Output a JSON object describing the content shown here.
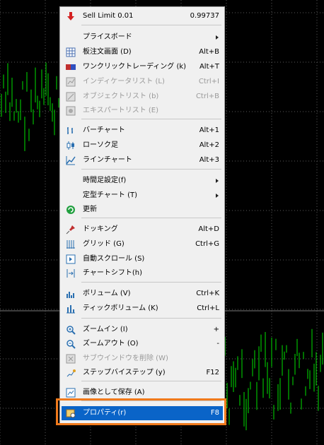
{
  "menu": {
    "items": [
      {
        "label": "Sell Limit 0.01",
        "shortcut": "0.99737",
        "icon": "sell-arrow-icon",
        "enabled": true
      },
      {
        "label": "プライスボード",
        "shortcut": "",
        "icon": "",
        "enabled": true,
        "submenu": true
      },
      {
        "label": "板注文画面 (D)",
        "shortcut": "Alt+B",
        "icon": "order-book-icon",
        "enabled": true
      },
      {
        "label": "ワンクリックトレーディング (k)",
        "shortcut": "Alt+T",
        "icon": "one-click-icon",
        "enabled": true
      },
      {
        "label": "インディケータリスト (L)",
        "shortcut": "Ctrl+I",
        "icon": "indicator-list-icon",
        "enabled": false
      },
      {
        "label": "オブジェクトリスト (b)",
        "shortcut": "Ctrl+B",
        "icon": "object-list-icon",
        "enabled": false
      },
      {
        "label": "エキスパートリスト (E)",
        "shortcut": "",
        "icon": "expert-list-icon",
        "enabled": false
      },
      {
        "label": "バーチャート",
        "shortcut": "Alt+1",
        "icon": "bar-chart-icon",
        "enabled": true
      },
      {
        "label": "ローソク足",
        "shortcut": "Alt+2",
        "icon": "candle-icon",
        "enabled": true
      },
      {
        "label": "ラインチャート",
        "shortcut": "Alt+3",
        "icon": "line-chart-icon",
        "enabled": true
      },
      {
        "label": "時間足設定(f)",
        "shortcut": "",
        "icon": "",
        "enabled": true,
        "submenu": true
      },
      {
        "label": "定型チャート (T)",
        "shortcut": "",
        "icon": "",
        "enabled": true,
        "submenu": true
      },
      {
        "label": "更新",
        "shortcut": "",
        "icon": "refresh-icon",
        "enabled": true
      },
      {
        "label": "ドッキング",
        "shortcut": "Alt+D",
        "icon": "pin-icon",
        "enabled": true
      },
      {
        "label": "グリッド (G)",
        "shortcut": "Ctrl+G",
        "icon": "grid-icon",
        "enabled": true
      },
      {
        "label": "自動スクロール (S)",
        "shortcut": "",
        "icon": "autoscroll-icon",
        "enabled": true
      },
      {
        "label": "チャートシフト(h)",
        "shortcut": "",
        "icon": "chart-shift-icon",
        "enabled": true
      },
      {
        "label": "ボリューム (V)",
        "shortcut": "Ctrl+K",
        "icon": "volume-icon",
        "enabled": true
      },
      {
        "label": "ティックボリューム (K)",
        "shortcut": "Ctrl+L",
        "icon": "tick-volume-icon",
        "enabled": true
      },
      {
        "label": "ズームイン (I)",
        "shortcut": "+",
        "icon": "zoom-in-icon",
        "enabled": true
      },
      {
        "label": "ズームアウト (O)",
        "shortcut": "-",
        "icon": "zoom-out-icon",
        "enabled": true
      },
      {
        "label": "サブウインドウを削除 (W)",
        "shortcut": "",
        "icon": "delete-subwindow-icon",
        "enabled": false
      },
      {
        "label": "ステップバイステップ (y)",
        "shortcut": "F12",
        "icon": "step-icon",
        "enabled": true
      },
      {
        "label": "画像として保存 (A)",
        "shortcut": "",
        "icon": "save-image-icon",
        "enabled": true
      },
      {
        "label": "プロパティ(r)",
        "shortcut": "F8",
        "icon": "properties-icon",
        "enabled": true,
        "highlighted": true
      }
    ]
  },
  "colors": {
    "chart_bg": "#000000",
    "grid": "#5a5a5a",
    "bar": "#00e000",
    "highlight": "#0a64c8",
    "annotation": "#f07a1c"
  }
}
